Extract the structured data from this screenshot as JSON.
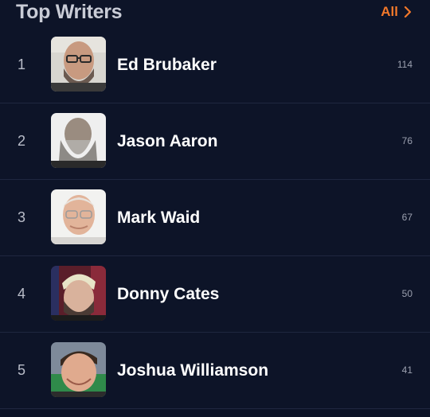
{
  "header": {
    "title": "Top Writers",
    "all_label": "All"
  },
  "writers": [
    {
      "rank": "1",
      "name": "Ed Brubaker",
      "count": "114",
      "avatar": "ed-brubaker-photo"
    },
    {
      "rank": "2",
      "name": "Jason Aaron",
      "count": "76",
      "avatar": "jason-aaron-photo"
    },
    {
      "rank": "3",
      "name": "Mark Waid",
      "count": "67",
      "avatar": "mark-waid-photo"
    },
    {
      "rank": "4",
      "name": "Donny Cates",
      "count": "50",
      "avatar": "donny-cates-photo"
    },
    {
      "rank": "5",
      "name": "Joshua Williamson",
      "count": "41",
      "avatar": "joshua-williamson-photo"
    }
  ],
  "colors": {
    "background": "#0d1428",
    "accent": "#f2782a",
    "divider": "#1f2740"
  }
}
